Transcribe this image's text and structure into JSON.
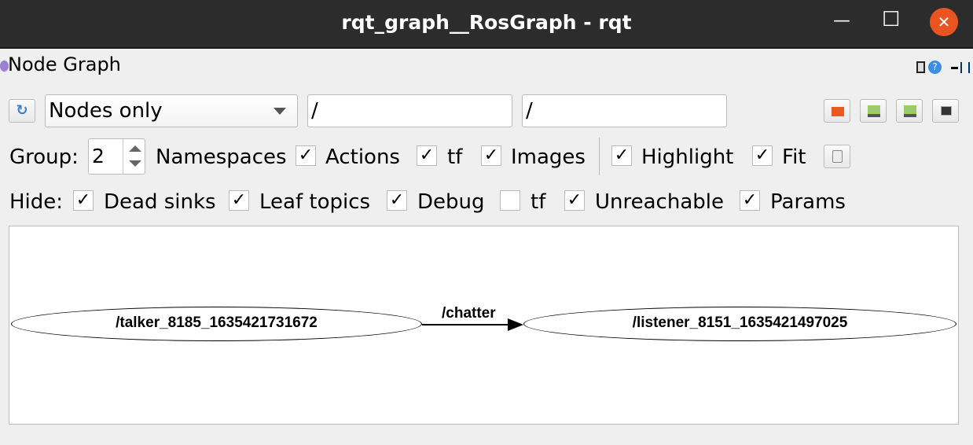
{
  "window": {
    "title": "rqt_graph__RosGraph - rqt",
    "minimize": "—",
    "maximize": "☐",
    "close": "✕"
  },
  "dock": {
    "title": "Node Graph"
  },
  "toolbar": {
    "mode": "Nodes only",
    "ns_filter": "/",
    "topic_filter": "/"
  },
  "group": {
    "label": "Group:",
    "value": "2"
  },
  "options": [
    {
      "label": "Namespaces"
    },
    {
      "label": "Actions",
      "checked": true
    },
    {
      "label": "tf",
      "checked": true
    },
    {
      "label": "Images",
      "checked": true
    },
    {
      "label": "Highlight",
      "checked": true
    },
    {
      "label": "Fit",
      "checked": true
    }
  ],
  "hide": {
    "label": "Hide:",
    "items": [
      {
        "label": "Dead sinks",
        "checked": true
      },
      {
        "label": "Leaf topics",
        "checked": true
      },
      {
        "label": "Debug",
        "checked": true
      },
      {
        "label": "tf",
        "checked": false
      },
      {
        "label": "Unreachable",
        "checked": true
      },
      {
        "label": "Params",
        "checked": true
      }
    ]
  },
  "graph": {
    "nodes": [
      "/talker_8185_1635421731672",
      "/listener_8151_1635421497025"
    ],
    "edge": "/chatter"
  },
  "check": "✓"
}
